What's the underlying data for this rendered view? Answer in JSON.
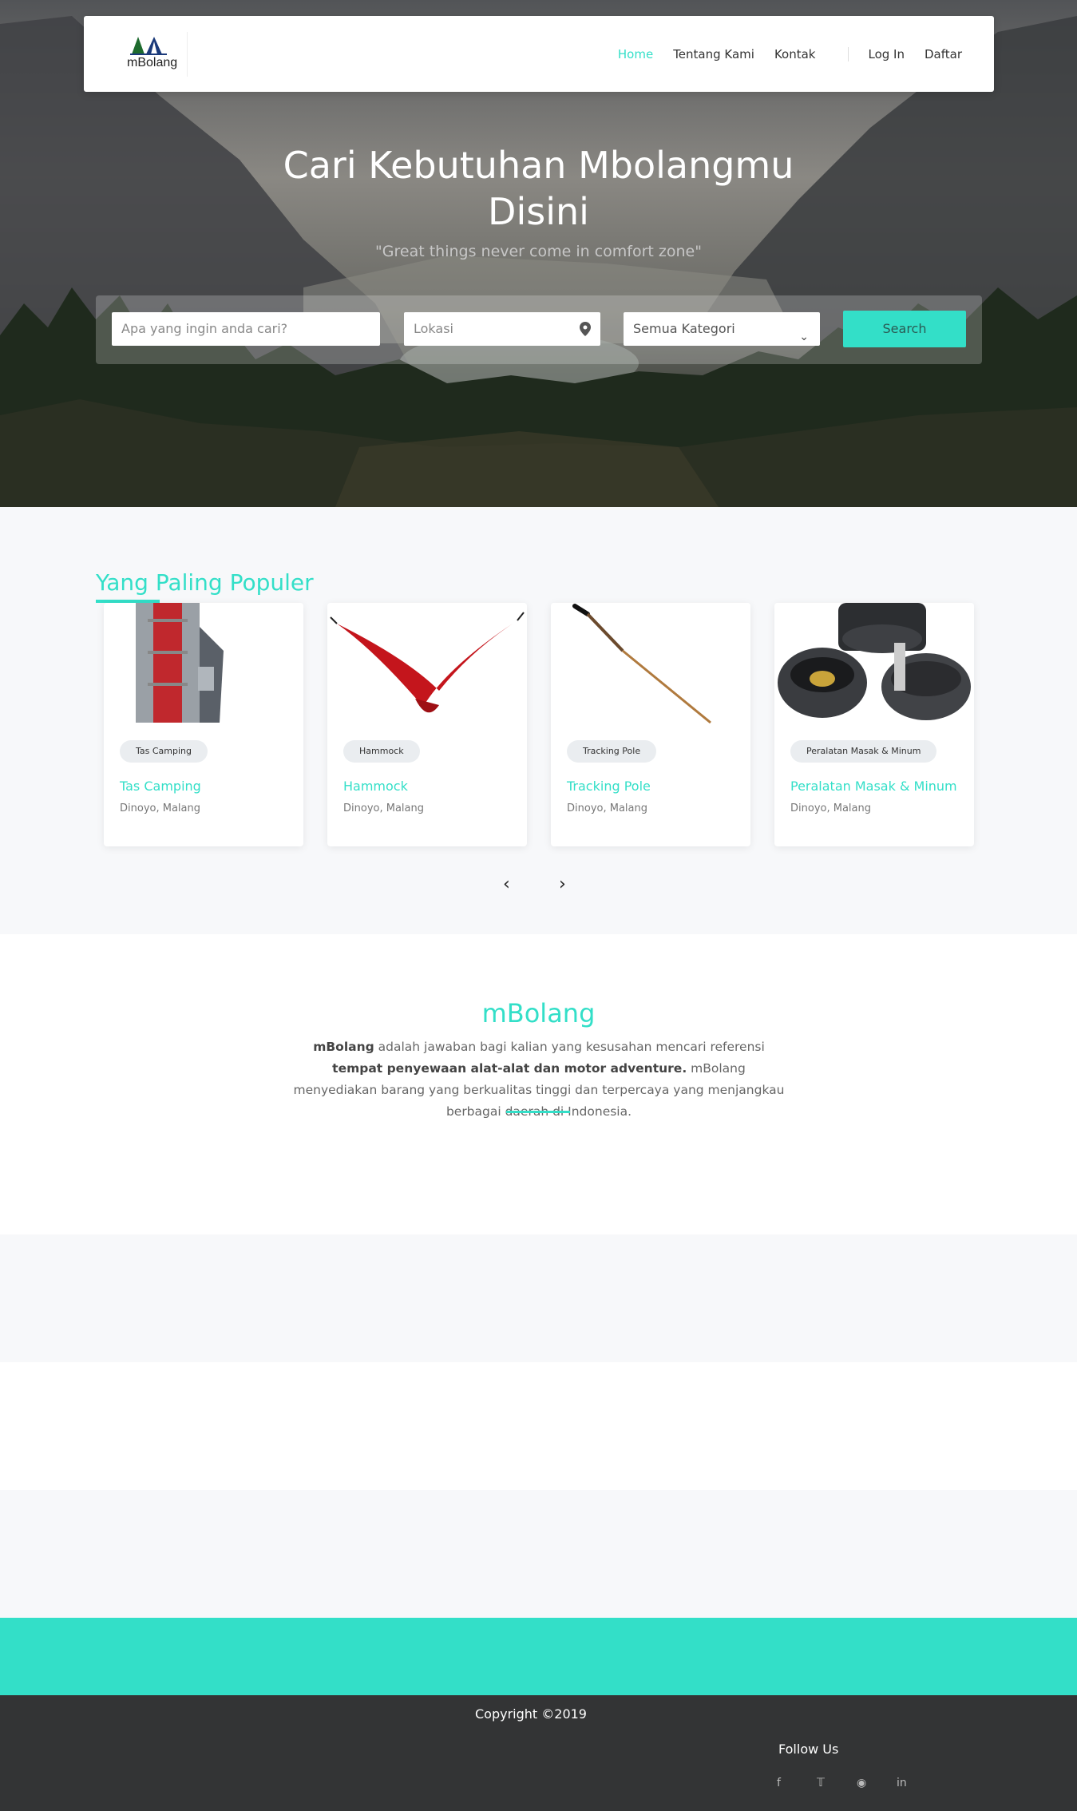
{
  "nav": {
    "logo_text": "mBolang",
    "links": [
      {
        "label": "Home",
        "active": true
      },
      {
        "label": "Tentang Kami",
        "active": false
      },
      {
        "label": "Kontak",
        "active": false
      }
    ],
    "auth": [
      {
        "label": "Log In"
      },
      {
        "label": "Daftar"
      }
    ]
  },
  "hero": {
    "title_line1": "Cari Kebutuhan Mbolangmu",
    "title_line2": "Disini",
    "subtitle": "\"Great things never come in comfort zone\""
  },
  "search": {
    "query_placeholder": "Apa yang ingin anda cari?",
    "location_placeholder": "Lokasi",
    "category_selected": "Semua Kategori",
    "button_label": "Search"
  },
  "popular": {
    "heading": "Yang Paling Populer",
    "items": [
      {
        "tag": "Tas Camping",
        "name": "Tas Camping",
        "location": "Dinoyo, Malang"
      },
      {
        "tag": "Hammock",
        "name": "Hammock",
        "location": "Dinoyo, Malang"
      },
      {
        "tag": "Tracking Pole",
        "name": "Tracking Pole",
        "location": "Dinoyo, Malang"
      },
      {
        "tag": "Peralatan Masak & Minum",
        "name": "Peralatan Masak & Minum",
        "location": "Dinoyo, Malang"
      }
    ],
    "prev_icon": "chevron-left-icon",
    "next_icon": "chevron-right-icon"
  },
  "about": {
    "title": "mBolang",
    "p_b1": "mBolang",
    "p_t1": " adalah jawaban bagi kalian yang kesusahan mencari referensi ",
    "p_b2": "tempat penyewaan alat-alat dan motor adventure.",
    "p_t2": " mBolang menyediakan barang yang berkualitas tinggi dan terpercaya yang menjangkau berbagai daerah di Indonesia."
  },
  "footer": {
    "copyright": "Copyright ©2019",
    "follow_label": "Follow Us",
    "socials": [
      "f",
      "t",
      "ig",
      "in"
    ]
  },
  "colors": {
    "accent": "#33dfc8",
    "footer_bg": "#333435",
    "section_bg": "#f7f8fa"
  }
}
